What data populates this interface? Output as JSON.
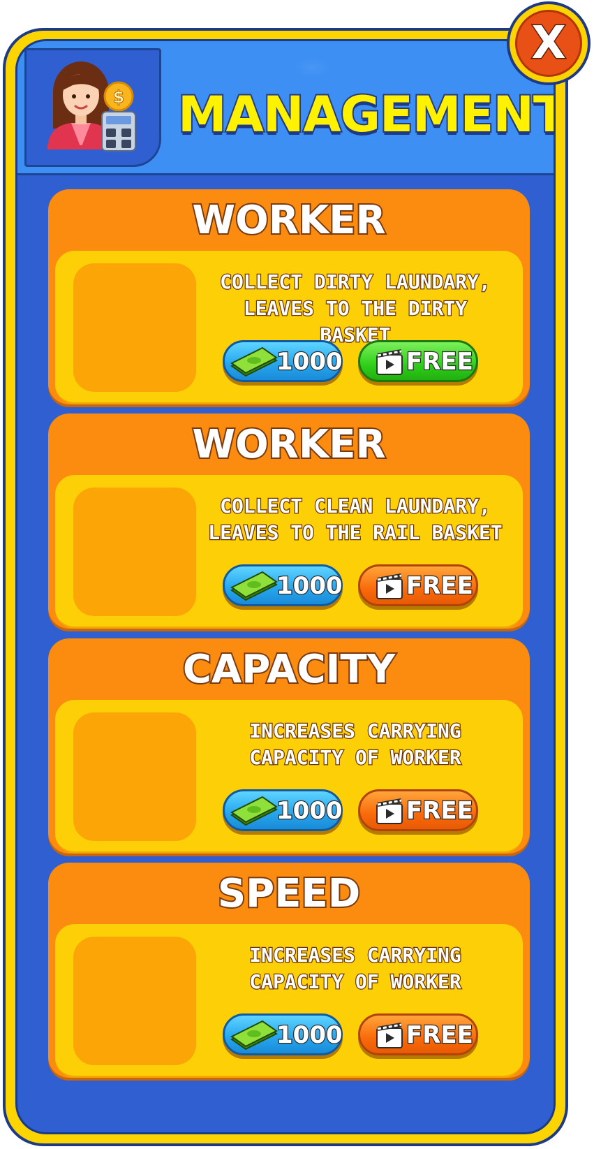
{
  "header": {
    "title": "MANAGEMENT",
    "avatar_icon": "accountant-avatar-icon",
    "close_label": "X"
  },
  "colors": {
    "panel_border": "#fcd400",
    "panel_bg": "#2f5fd0",
    "header_bg": "#3d8ff4",
    "title_color": "#fff200",
    "card_bg": "#fb8c10",
    "card_body_bg": "#fdcf06",
    "cash_button": "#28a8f0",
    "free_button_active": "#2fcf1a",
    "free_button": "#f96a0a",
    "close_button": "#e85015"
  },
  "upgrades": [
    {
      "title": "WORKER",
      "description": "COLLECT DIRTY LAUNDARY,\nLEAVES TO THE DIRTY BASKET",
      "price": "1000",
      "free_label": "FREE",
      "free_active": true
    },
    {
      "title": "WORKER",
      "description": "COLLECT CLEAN LAUNDARY,\nLEAVES TO THE RAIL BASKET",
      "price": "1000",
      "free_label": "FREE",
      "free_active": false
    },
    {
      "title": "CAPACITY",
      "description": "INCREASES CARRYING\nCAPACITY OF WORKER",
      "price": "1000",
      "free_label": "FREE",
      "free_active": false
    },
    {
      "title": "SPEED",
      "description": "INCREASES CARRYING\nCAPACITY OF WORKER",
      "price": "1000",
      "free_label": "FREE",
      "free_active": false
    }
  ]
}
